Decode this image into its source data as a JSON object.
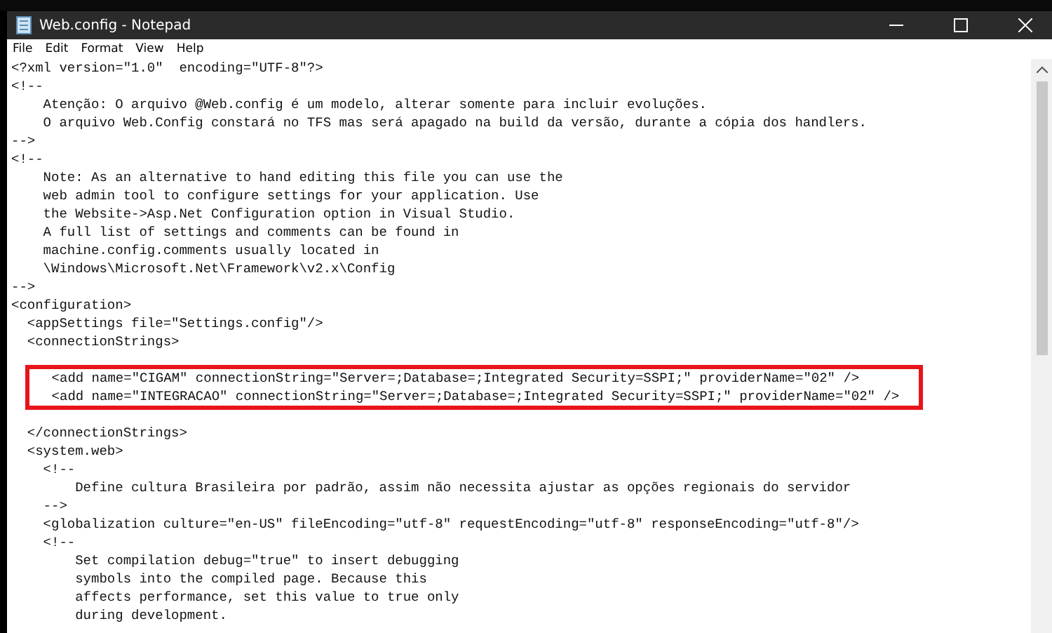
{
  "window": {
    "title": "Web.config - Notepad"
  },
  "menu": [
    "File",
    "Edit",
    "Format",
    "View",
    "Help"
  ],
  "editor": {
    "lines_before": [
      "<?xml version=\"1.0\"  encoding=\"UTF-8\"?>",
      "<!--",
      "    Atenção: O arquivo @Web.config é um modelo, alterar somente para incluir evoluções.",
      "    O arquivo Web.Config constará no TFS mas será apagado na build da versão, durante a cópia dos handlers.",
      "-->",
      "<!--",
      "    Note: As an alternative to hand editing this file you can use the",
      "    web admin tool to configure settings for your application. Use",
      "    the Website->Asp.Net Configuration option in Visual Studio.",
      "    A full list of settings and comments can be found in",
      "    machine.config.comments usually located in",
      "    \\Windows\\Microsoft.Net\\Framework\\v2.x\\Config",
      "-->",
      "<configuration>",
      "  <appSettings file=\"Settings.config\"/>",
      "  <connectionStrings>"
    ],
    "highlighted_lines": [
      "    <add name=\"CIGAM\" connectionString=\"Server=;Database=;Integrated Security=SSPI;\" providerName=\"02\" />",
      "    <add name=\"INTEGRACAO\" connectionString=\"Server=;Database=;Integrated Security=SSPI;\" providerName=\"02\" />"
    ],
    "lines_after": [
      "  </connectionStrings>",
      "  <system.web>",
      "    <!--",
      "        Define cultura Brasileira por padrão, assim não necessita ajustar as opções regionais do servidor",
      "    -->",
      "    <globalization culture=\"en-US\" fileEncoding=\"utf-8\" requestEncoding=\"utf-8\" responseEncoding=\"utf-8\"/>",
      "    <!--",
      "        Set compilation debug=\"true\" to insert debugging",
      "        symbols into the compiled page. Because this",
      "        affects performance, set this value to true only",
      "        during development."
    ]
  }
}
